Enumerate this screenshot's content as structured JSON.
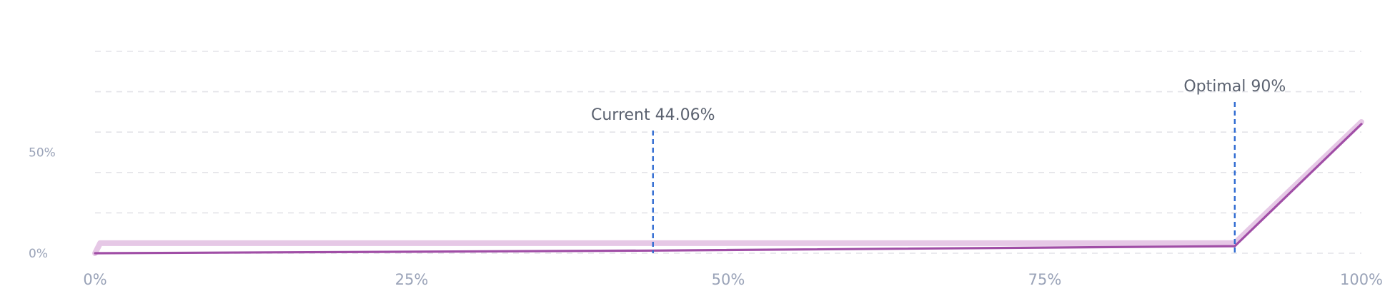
{
  "chart_data": {
    "type": "line",
    "x_ticks": [
      "0%",
      "25%",
      "50%",
      "75%",
      "100%"
    ],
    "y_ticks": [
      "0%",
      "50%"
    ],
    "xlim": [
      0,
      100
    ],
    "ylim": [
      0,
      100
    ],
    "y_gridlines": [
      0,
      20,
      40,
      60,
      80,
      100
    ],
    "grid": true,
    "series": [
      {
        "x": [
          0,
          44.06,
          90,
          100
        ],
        "values": [
          0,
          1.3,
          3.5,
          64
        ],
        "color": "#a04ea6"
      },
      {
        "x": [
          0,
          0.4,
          90,
          100
        ],
        "values": [
          0,
          5,
          5,
          65
        ],
        "color": "#e6c8e6"
      }
    ],
    "markers": [
      {
        "x": 44.06,
        "label": "Current 44.06%",
        "color": "#2f6bd2"
      },
      {
        "x": 90,
        "label": "Optimal 90%",
        "color": "#2f6bd2"
      }
    ]
  }
}
